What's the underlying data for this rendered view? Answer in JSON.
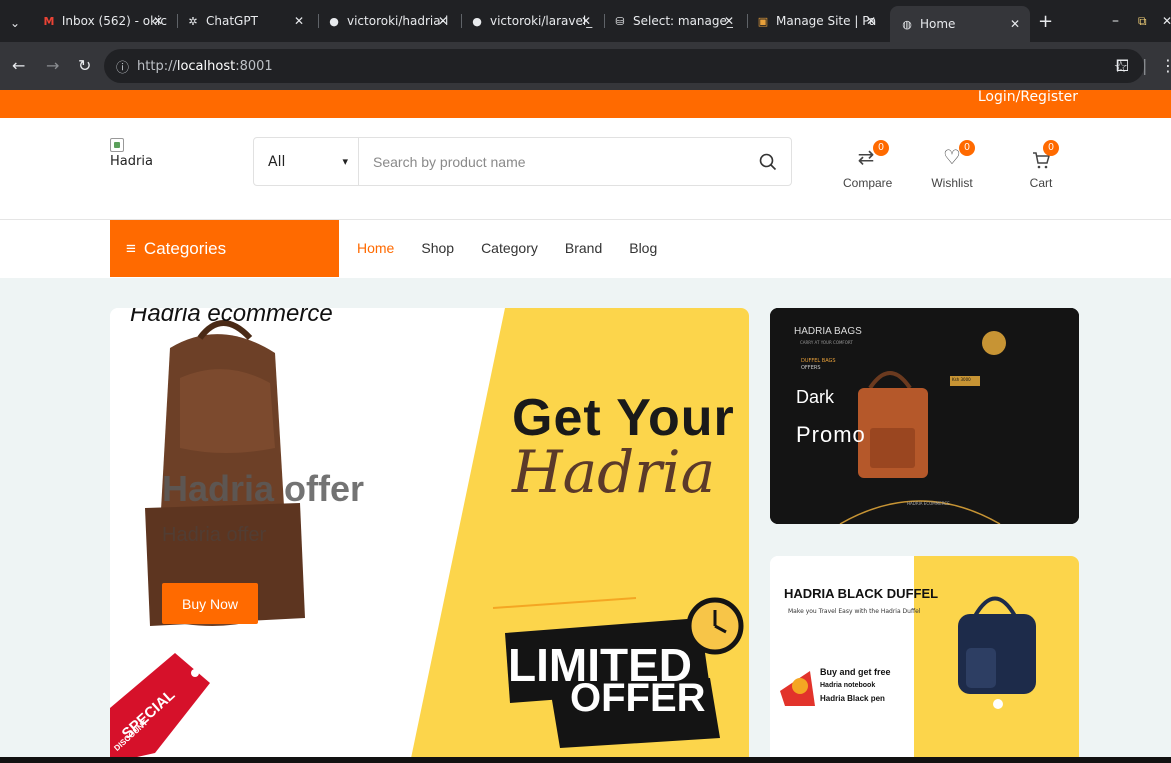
{
  "browser": {
    "tabs": [
      {
        "label": "Inbox (562) - okic",
        "icon": "gmail-icon"
      },
      {
        "label": "ChatGPT",
        "icon": "chatgpt-icon"
      },
      {
        "label": "victoroki/hadria-l",
        "icon": "github-icon"
      },
      {
        "label": "victoroki/laravel_",
        "icon": "github-icon"
      },
      {
        "label": "Select: manage_",
        "icon": "db-icon"
      },
      {
        "label": "Manage Site | Pa",
        "icon": "site-icon"
      },
      {
        "label": "Home",
        "icon": "globe-icon",
        "active": true
      }
    ],
    "url_scheme": "http://",
    "url_host": "localhost",
    "url_port": ":8001"
  },
  "topbar": {
    "login_label": "Login/Register"
  },
  "header": {
    "logo_alt": "Hadria",
    "category_select": "All",
    "search_placeholder": "Search by product name",
    "compare": {
      "label": "Compare",
      "count": "0"
    },
    "wishlist": {
      "label": "Wishlist",
      "count": "0"
    },
    "cart": {
      "label": "Cart",
      "count": "0"
    }
  },
  "nav": {
    "categories_label": "Categories",
    "menu": [
      "Home",
      "Shop",
      "Category",
      "Brand",
      "Blog"
    ],
    "active_item": "Home"
  },
  "hero": {
    "overlay_title": "Hadria ecommerce",
    "promo_title": "Hadria offer",
    "promo_subtitle": "Hadria offer",
    "buy_label": "Buy Now",
    "image_text": {
      "get_your": "Get Your",
      "script": "Hadria",
      "limited": "LIMITED",
      "offer": "OFFER",
      "tag_line1": "SPECIAL",
      "tag_line2": "DISCOUNT"
    }
  },
  "banner1": {
    "brand": "HADRIA BAGS",
    "tagline": "CARRY AT YOUR COMFORT",
    "duffel": "DUFFEL BAGS",
    "offers": "OFFERS",
    "price": "Ksh 3000",
    "footer": "HADRIA ECOMMERCE",
    "overlay_line1": "Dark",
    "overlay_line2": "Promo"
  },
  "banner2": {
    "title": "HADRIA BLACK DUFFEL",
    "subtitle": "Make you Travel Easy with the Hadria Duffel",
    "offer_line1": "Buy and get free",
    "offer_line2": "Hadria notebook",
    "offer_line3": "Hadria Black pen"
  },
  "colors": {
    "accent": "#ff6a00",
    "hero_yellow": "#fcd54b",
    "dark": "#141414"
  }
}
